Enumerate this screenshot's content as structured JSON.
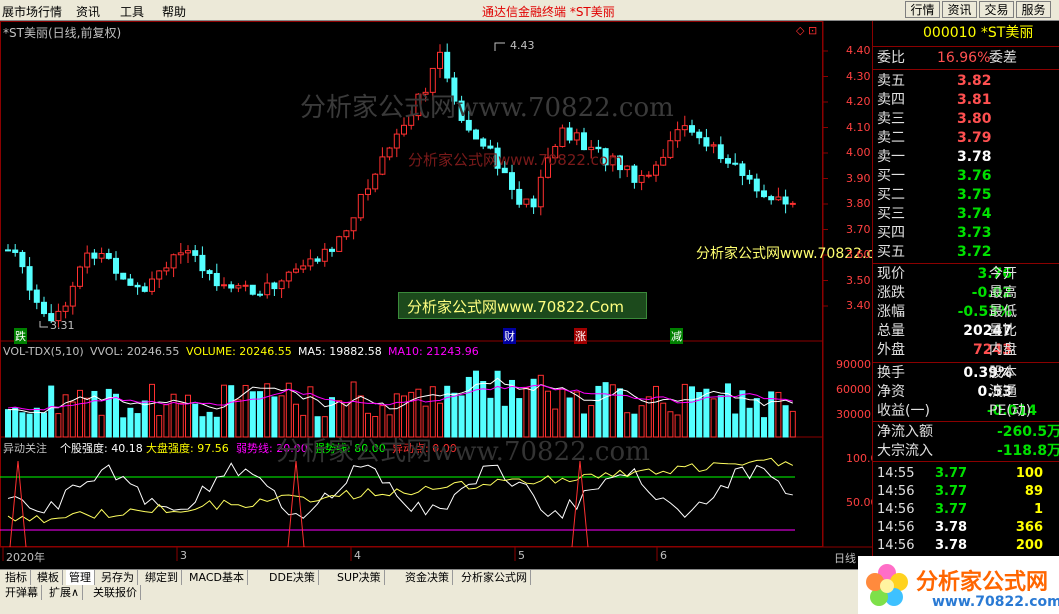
{
  "menubar": {
    "items": [
      "展市场行情",
      "资讯",
      "工具",
      "帮助"
    ],
    "center_text": "通达信金融终端    *ST美丽",
    "right_buttons": [
      "行情",
      "资讯",
      "交易",
      "服务"
    ]
  },
  "chart_header": {
    "title": "*ST美丽(日线,前复权)",
    "watermark_top": "分析家公式网www.70822.com",
    "watermark_mid": "分析家公式网www.70822.com",
    "watermark_banner": "分析家公式网www.70822.Com",
    "watermark_right": "分析家公式网www.70822.com",
    "high_label": "4.43",
    "low_label": "3.31",
    "event_labels": [
      "跌",
      "财",
      "涨",
      "减"
    ]
  },
  "price_axis": [
    "4.40",
    "4.30",
    "4.20",
    "4.10",
    "4.00",
    "3.90",
    "3.80",
    "3.70",
    "3.60",
    "3.50",
    "3.40"
  ],
  "vol_header": {
    "name": "VOL-TDX(5,10)",
    "vvol": "VVOL: 20246.55",
    "volume": "VOLUME: 20246.55",
    "ma5": "MA5: 19882.58",
    "ma10": "MA10: 21243.96"
  },
  "vol_axis": [
    "90000",
    "60000",
    "30000"
  ],
  "ind_header": {
    "name": "异动关注",
    "ggqd": "个股强度: 40.18",
    "dpqd": "大盘强度: 97.56",
    "ruo": "弱势线: 20.00",
    "qiang": "强势线: 80.00",
    "ydd": "异动点: 0.00"
  },
  "ind_axis": [
    "100.0",
    "50.00"
  ],
  "time_axis": [
    "2020年",
    "3",
    "4",
    "5",
    "6"
  ],
  "period_label": "日线",
  "stock": {
    "code": "000010",
    "name": "*ST美丽",
    "weibi_label": "委比",
    "weibi": "16.96%",
    "weicha_label": "委差",
    "asks": [
      {
        "label": "卖五",
        "price": "3.82"
      },
      {
        "label": "卖四",
        "price": "3.81"
      },
      {
        "label": "卖三",
        "price": "3.80"
      },
      {
        "label": "卖二",
        "price": "3.79"
      },
      {
        "label": "卖一",
        "price": "3.78"
      }
    ],
    "bids": [
      {
        "label": "买一",
        "price": "3.76"
      },
      {
        "label": "买二",
        "price": "3.75"
      },
      {
        "label": "买三",
        "price": "3.74"
      },
      {
        "label": "买四",
        "price": "3.73"
      },
      {
        "label": "买五",
        "price": "3.72"
      }
    ],
    "stats": [
      {
        "l1": "现价",
        "v": "3.76",
        "l2": "今开"
      },
      {
        "l1": "涨跌",
        "v": "-0.02",
        "l2": "最高"
      },
      {
        "l1": "涨幅",
        "v": "-0.53%",
        "l2": "最低"
      },
      {
        "l1": "总量",
        "v": "20247",
        "l2": "量比"
      },
      {
        "l1": "外盘",
        "v": "7243",
        "l2": "内盘"
      }
    ],
    "stats2": [
      {
        "l1": "换手",
        "v": "0.39%",
        "l2": "股本"
      },
      {
        "l1": "净资",
        "v": "0.53",
        "l2": "流通"
      },
      {
        "l1": "收益(一)",
        "v": "-0.014",
        "l2": "PE(动)"
      }
    ],
    "flow": [
      {
        "l": "净流入额",
        "v": "-260.5万"
      },
      {
        "l": "大宗流入",
        "v": "-118.8万"
      }
    ],
    "ticks": [
      {
        "t": "14:55",
        "p": "3.77",
        "v": "100"
      },
      {
        "t": "14:56",
        "p": "3.77",
        "v": "89"
      },
      {
        "t": "14:56",
        "p": "3.77",
        "v": "1"
      },
      {
        "t": "14:56",
        "p": "3.78",
        "v": "366"
      },
      {
        "t": "14:56",
        "p": "3.78",
        "v": "200"
      }
    ]
  },
  "tabs_row1": [
    "指标",
    "模板",
    "管理",
    "另存为",
    "绑定到",
    "MACD基本",
    "DDE决策",
    "SUP决策",
    "资金决策",
    "分析家公式网"
  ],
  "tabs_row2": [
    "开弹幕",
    "扩展∧",
    "关联报价"
  ],
  "logo": {
    "line1": "分析家公式网",
    "line2": "www.70822.com"
  },
  "colors": {
    "up": "#ff3030",
    "down": "#54ffff",
    "grid": "#8b0000",
    "ma5": "#ffffff",
    "ma10": "#ff00ff"
  }
}
